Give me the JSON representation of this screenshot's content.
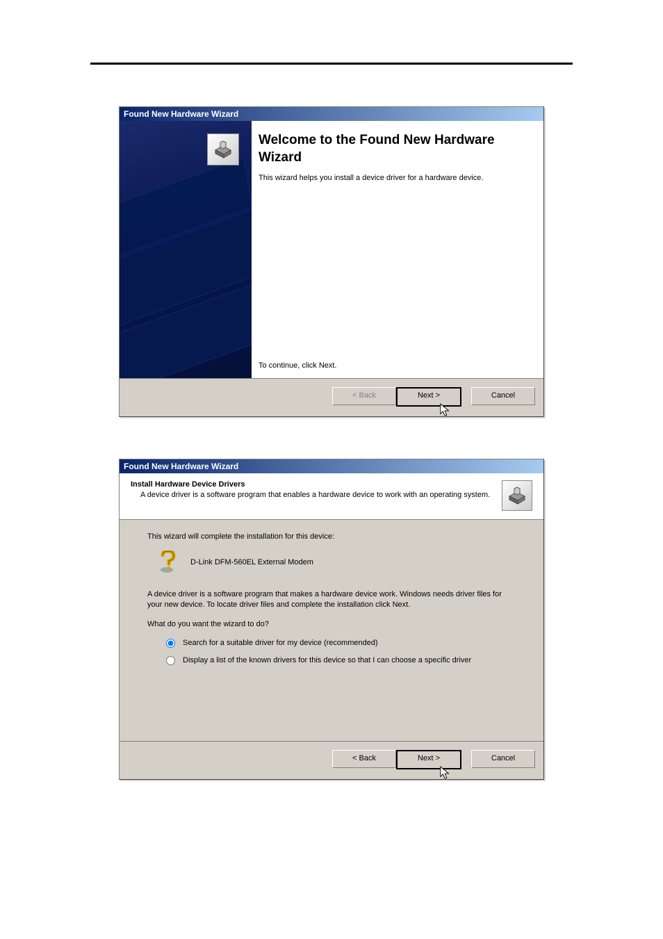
{
  "dialog1": {
    "title": "Found New Hardware Wizard",
    "heading": "Welcome to the Found New Hardware Wizard",
    "description": "This wizard helps you install a device driver for a hardware device.",
    "continue_hint": "To continue, click Next.",
    "buttons": {
      "back": "< Back",
      "next": "Next >",
      "cancel": "Cancel"
    }
  },
  "dialog2": {
    "title": "Found New Hardware Wizard",
    "header_title": "Install Hardware Device Drivers",
    "header_sub": "A device driver is a software program that enables a hardware device to work with an operating system.",
    "intro_line": "This wizard will complete the installation for this device:",
    "device_name": "D-Link DFM-560EL External Modem",
    "explain": "A device driver is a software program that makes a hardware device work. Windows needs driver files for your new device. To locate driver files and complete the installation click Next.",
    "question": "What do you want the wizard to do?",
    "option1": "Search for a suitable driver for my device (recommended)",
    "option2": "Display a list of the known drivers for this device so that I can choose a specific driver",
    "buttons": {
      "back": "< Back",
      "next": "Next >",
      "cancel": "Cancel"
    }
  }
}
